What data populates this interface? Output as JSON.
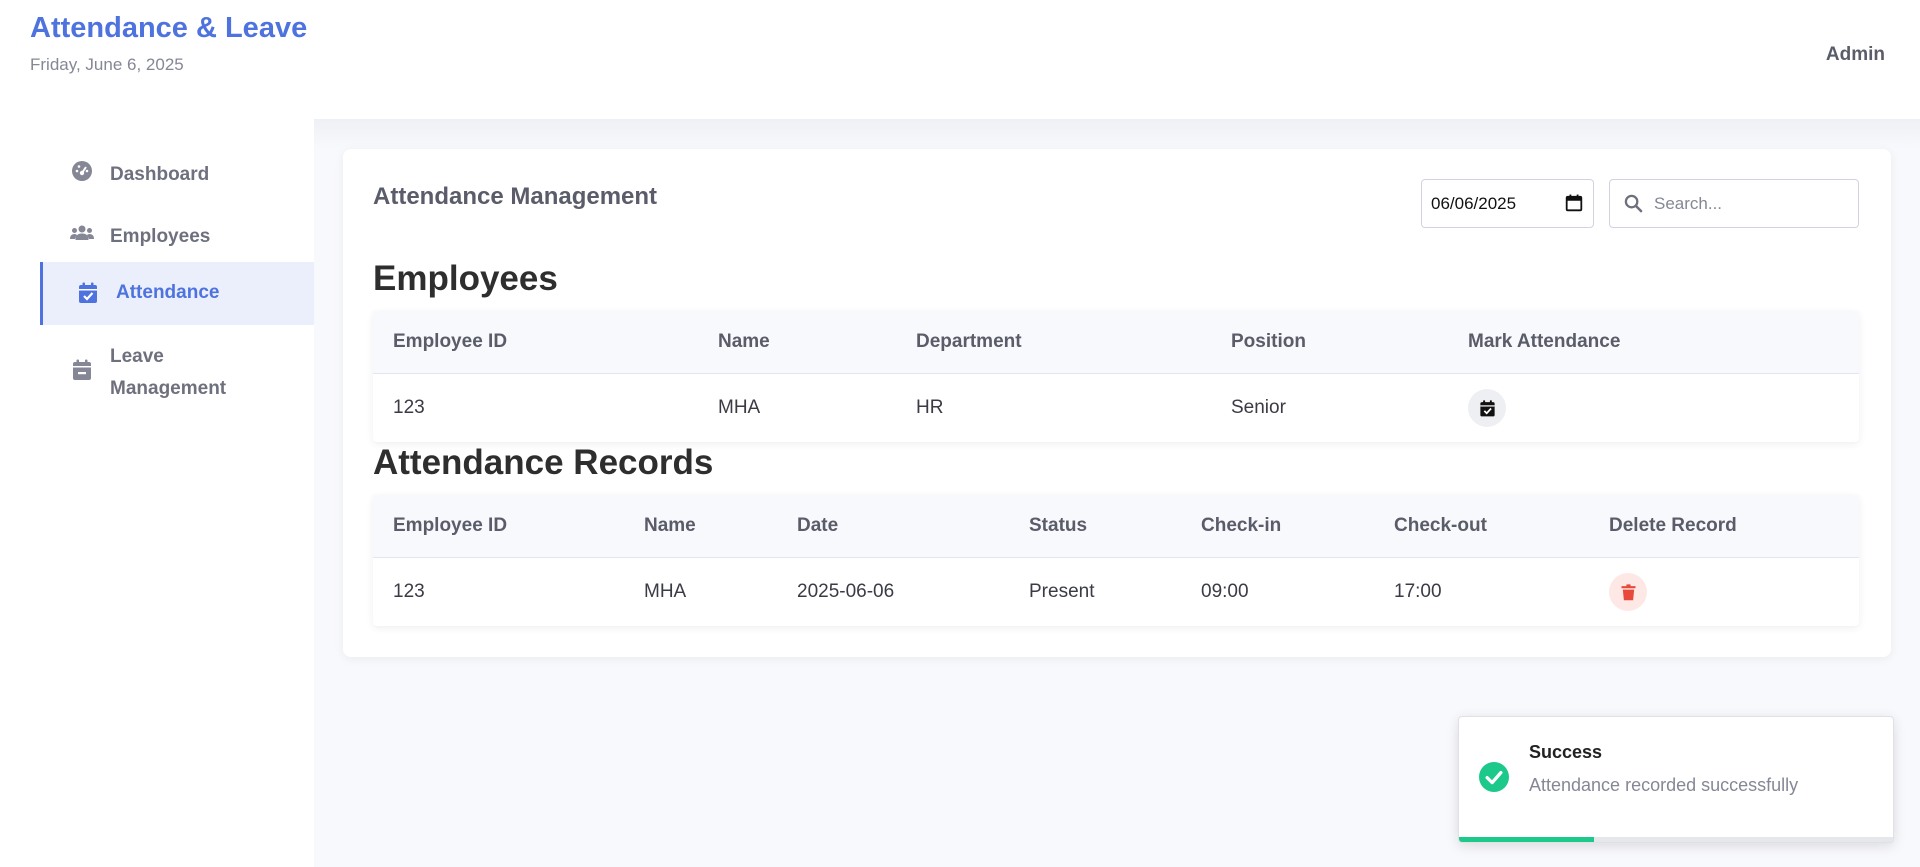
{
  "header": {
    "title": "Attendance & Leave",
    "date": "Friday, June 6, 2025",
    "user": "Admin"
  },
  "sidebar": {
    "items": [
      {
        "label": "Dashboard",
        "icon": "dashboard-icon",
        "active": false
      },
      {
        "label": "Employees",
        "icon": "users-icon",
        "active": false
      },
      {
        "label": "Attendance",
        "icon": "calendar-check-icon",
        "active": true
      },
      {
        "label": "Leave Management",
        "icon": "calendar-minus-icon",
        "active": false
      }
    ]
  },
  "main": {
    "title": "Attendance Management",
    "date_value": "06/06/2025",
    "search_placeholder": "Search...",
    "employees": {
      "heading": "Employees",
      "columns": [
        "Employee ID",
        "Name",
        "Department",
        "Position",
        "Mark Attendance"
      ],
      "rows": [
        {
          "id": "123",
          "name": "MHA",
          "department": "HR",
          "position": "Senior"
        }
      ]
    },
    "records": {
      "heading": "Attendance Records",
      "columns": [
        "Employee ID",
        "Name",
        "Date",
        "Status",
        "Check-in",
        "Check-out",
        "Delete Record"
      ],
      "rows": [
        {
          "id": "123",
          "name": "MHA",
          "date": "2025-06-06",
          "status": "Present",
          "check_in": "09:00",
          "check_out": "17:00"
        }
      ]
    }
  },
  "toast": {
    "title": "Success",
    "message": "Attendance recorded successfully",
    "progress": 0.31
  },
  "colors": {
    "accent": "#4e73df",
    "success": "#1cc88a",
    "danger": "#e74a3b"
  }
}
